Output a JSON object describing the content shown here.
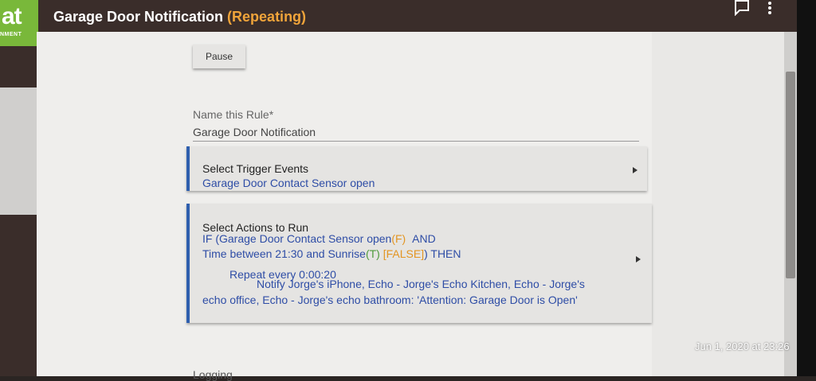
{
  "header": {
    "logo_text": "at",
    "logo_sub": "NMENT",
    "title": "Garage Door Notification",
    "title_tag": "(Repeating)",
    "icons": [
      "comment-icon",
      "more-vert-icon"
    ]
  },
  "pause_label": "Pause",
  "name_field": {
    "label": "Name this Rule*",
    "value": "Garage Door Notification"
  },
  "trigger_card": {
    "title": "Select Trigger Events",
    "value": "Garage Door Contact Sensor open"
  },
  "actions_card": {
    "title": "Select Actions to Run",
    "line1_a": "IF (Garage Door Contact Sensor open",
    "line1_f": "(F)",
    "line1_and": "AND",
    "line2_a": "Time between 21:30 and Sunrise",
    "line2_t": "(T)",
    "line2_false": "[FALSE]",
    "line2_then": ") THEN",
    "line3": "Repeat every 0:00:20",
    "line4": "Notify Jorge's iPhone, Echo - Jorge's Echo Kitchen, Echo - Jorge's",
    "line5": "echo office, Echo - Jorge's echo bathroom: 'Attention: Garage Door is Open'"
  },
  "logging_label": "Logging",
  "timestamp": "Jun 1, 2020 at 23:26",
  "colors": {
    "accent_blue": "#2f5fae",
    "tag_orange": "#f0a43a",
    "logo_green": "#79b83a"
  }
}
